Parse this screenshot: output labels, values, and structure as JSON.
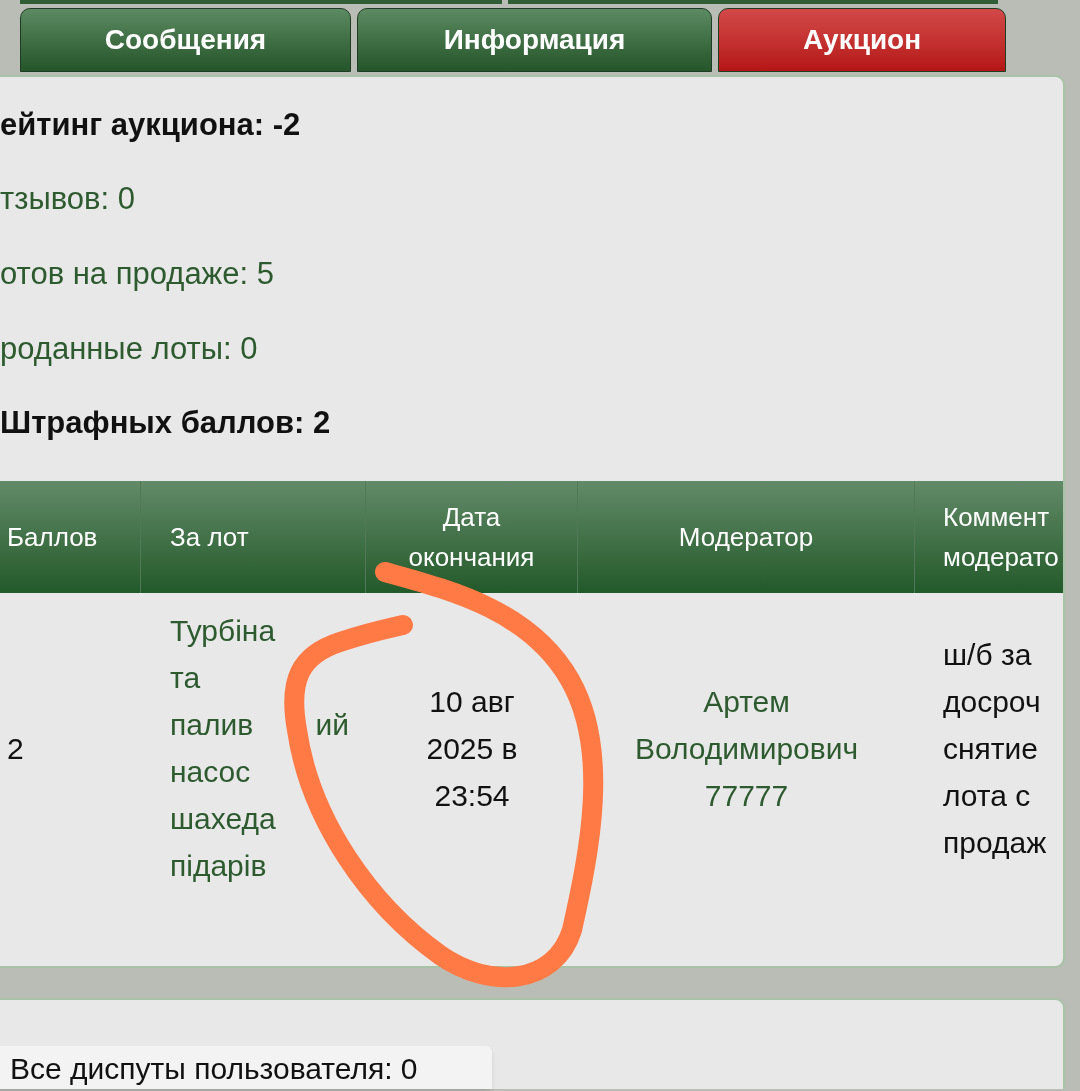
{
  "tabs": [
    {
      "label": "Сообщения",
      "selected": false
    },
    {
      "label": "Информация",
      "selected": false
    },
    {
      "label": "Аукцион",
      "selected": true
    }
  ],
  "summary": {
    "rating": "ейтинг аукциона: -2",
    "stats": [
      "тзывов: 0",
      "отов на продаже: 5",
      "роданные лоты: 0"
    ],
    "penalty": "Штрафных баллов: 2"
  },
  "table": {
    "columns": [
      "Баллов",
      "За лот",
      "Дата\nокончания",
      "Модератор",
      "Коммент\nмодерато"
    ],
    "rows": [
      {
        "cells": [
          {
            "text": "2",
            "kind": "plain"
          },
          {
            "text": "Турбіна\nта\nпалив ий\nнасос\nшахеда\nпідарів",
            "kind": "link"
          },
          {
            "text": "10 авг\n2025 в\n23:54",
            "kind": "plain"
          },
          {
            "text": "Артем\nВолодимирович\n77777",
            "kind": "link"
          },
          {
            "text": "ш/б за\nдосроч\nснятие\nлота с\nпродаж",
            "kind": "plain"
          }
        ]
      }
    ]
  },
  "disputes": {
    "label": "Все диспуты пользователя: 0"
  }
}
